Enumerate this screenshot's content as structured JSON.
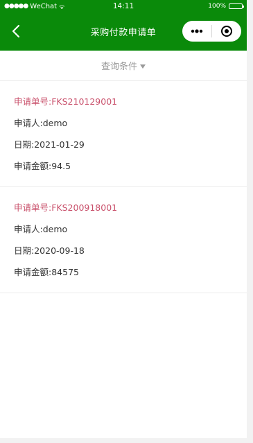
{
  "status_bar": {
    "carrier": "WeChat",
    "time": "14:11",
    "battery": "100%"
  },
  "nav": {
    "title": "采购付款申请单"
  },
  "filter": {
    "label": "查询条件"
  },
  "records": [
    {
      "code_label": "申请单号:",
      "code": "FKS210129001",
      "applicant_label": "申请人:",
      "applicant": "demo",
      "date_label": "日期:",
      "date": "2021-01-29",
      "amount_label": "申请金额:",
      "amount": "94.5"
    },
    {
      "code_label": "申请单号:",
      "code": "FKS200918001",
      "applicant_label": "申请人:",
      "applicant": "demo",
      "date_label": "日期:",
      "date": "2020-09-18",
      "amount_label": "申请金额:",
      "amount": "84575"
    }
  ],
  "colors": {
    "nav_bg": "#0a8a0a",
    "code_text": "#c9506b",
    "body_text": "#333333",
    "muted_text": "#999999"
  }
}
